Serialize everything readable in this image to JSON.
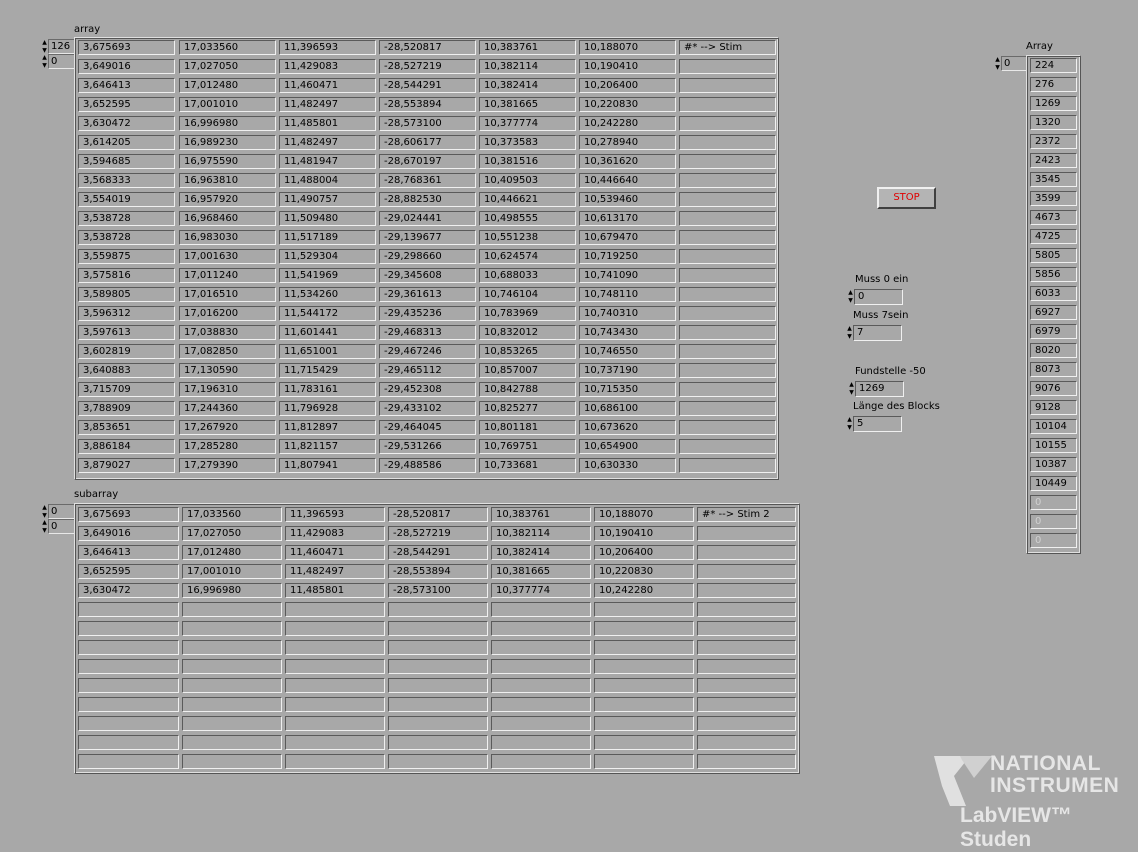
{
  "array": {
    "label": "array",
    "index_row": "126",
    "index_col": "0",
    "rows": [
      [
        "3,675693",
        "17,033560",
        "11,396593",
        "-28,520817",
        "10,383761",
        "10,188070",
        "#*    -->    Stim"
      ],
      [
        "3,649016",
        "17,027050",
        "11,429083",
        "-28,527219",
        "10,382114",
        "10,190410",
        ""
      ],
      [
        "3,646413",
        "17,012480",
        "11,460471",
        "-28,544291",
        "10,382414",
        "10,206400",
        ""
      ],
      [
        "3,652595",
        "17,001010",
        "11,482497",
        "-28,553894",
        "10,381665",
        "10,220830",
        ""
      ],
      [
        "3,630472",
        "16,996980",
        "11,485801",
        "-28,573100",
        "10,377774",
        "10,242280",
        ""
      ],
      [
        "3,614205",
        "16,989230",
        "11,482497",
        "-28,606177",
        "10,373583",
        "10,278940",
        ""
      ],
      [
        "3,594685",
        "16,975590",
        "11,481947",
        "-28,670197",
        "10,381516",
        "10,361620",
        ""
      ],
      [
        "3,568333",
        "16,963810",
        "11,488004",
        "-28,768361",
        "10,409503",
        "10,446640",
        ""
      ],
      [
        "3,554019",
        "16,957920",
        "11,490757",
        "-28,882530",
        "10,446621",
        "10,539460",
        ""
      ],
      [
        "3,538728",
        "16,968460",
        "11,509480",
        "-29,024441",
        "10,498555",
        "10,613170",
        ""
      ],
      [
        "3,538728",
        "16,983030",
        "11,517189",
        "-29,139677",
        "10,551238",
        "10,679470",
        ""
      ],
      [
        "3,559875",
        "17,001630",
        "11,529304",
        "-29,298660",
        "10,624574",
        "10,719250",
        ""
      ],
      [
        "3,575816",
        "17,011240",
        "11,541969",
        "-29,345608",
        "10,688033",
        "10,741090",
        ""
      ],
      [
        "3,589805",
        "17,016510",
        "11,534260",
        "-29,361613",
        "10,746104",
        "10,748110",
        ""
      ],
      [
        "3,596312",
        "17,016200",
        "11,544172",
        "-29,435236",
        "10,783969",
        "10,740310",
        ""
      ],
      [
        "3,597613",
        "17,038830",
        "11,601441",
        "-29,468313",
        "10,832012",
        "10,743430",
        ""
      ],
      [
        "3,602819",
        "17,082850",
        "11,651001",
        "-29,467246",
        "10,853265",
        "10,746550",
        ""
      ],
      [
        "3,640883",
        "17,130590",
        "11,715429",
        "-29,465112",
        "10,857007",
        "10,737190",
        ""
      ],
      [
        "3,715709",
        "17,196310",
        "11,783161",
        "-29,452308",
        "10,842788",
        "10,715350",
        ""
      ],
      [
        "3,788909",
        "17,244360",
        "11,796928",
        "-29,433102",
        "10,825277",
        "10,686100",
        ""
      ],
      [
        "3,853651",
        "17,267920",
        "11,812897",
        "-29,464045",
        "10,801181",
        "10,673620",
        ""
      ],
      [
        "3,886184",
        "17,285280",
        "11,821157",
        "-29,531266",
        "10,769751",
        "10,654900",
        ""
      ],
      [
        "3,879027",
        "17,279390",
        "11,807941",
        "-29,488586",
        "10,733681",
        "10,630330",
        ""
      ]
    ]
  },
  "subarray": {
    "label": "subarray",
    "index_row": "0",
    "index_col": "0",
    "rows": [
      [
        "3,675693",
        "17,033560",
        "11,396593",
        "-28,520817",
        "10,383761",
        "10,188070",
        "#*    -->     Stim 2"
      ],
      [
        "3,649016",
        "17,027050",
        "11,429083",
        "-28,527219",
        "10,382114",
        "10,190410",
        ""
      ],
      [
        "3,646413",
        "17,012480",
        "11,460471",
        "-28,544291",
        "10,382414",
        "10,206400",
        ""
      ],
      [
        "3,652595",
        "17,001010",
        "11,482497",
        "-28,553894",
        "10,381665",
        "10,220830",
        ""
      ],
      [
        "3,630472",
        "16,996980",
        "11,485801",
        "-28,573100",
        "10,377774",
        "10,242280",
        ""
      ],
      [
        "",
        "",
        "",
        "",
        "",
        "",
        ""
      ],
      [
        "",
        "",
        "",
        "",
        "",
        "",
        ""
      ],
      [
        "",
        "",
        "",
        "",
        "",
        "",
        ""
      ],
      [
        "",
        "",
        "",
        "",
        "",
        "",
        ""
      ],
      [
        "",
        "",
        "",
        "",
        "",
        "",
        ""
      ],
      [
        "",
        "",
        "",
        "",
        "",
        "",
        ""
      ],
      [
        "",
        "",
        "",
        "",
        "",
        "",
        ""
      ],
      [
        "",
        "",
        "",
        "",
        "",
        "",
        ""
      ],
      [
        "",
        "",
        "",
        "",
        "",
        "",
        ""
      ]
    ]
  },
  "stop_button": {
    "label": "STOP",
    "color": "#e00000"
  },
  "controls": {
    "muss0": {
      "label": "Muss 0 ein",
      "value": "0"
    },
    "muss7": {
      "label": "Muss 7sein",
      "value": "7"
    },
    "fundstelle": {
      "label": "Fundstelle -50",
      "value": "1269"
    },
    "laenge": {
      "label": "Länge des Blocks",
      "value": "5"
    }
  },
  "found_array": {
    "label": "Array",
    "index": "0",
    "values": [
      "224",
      "276",
      "1269",
      "1320",
      "2372",
      "2423",
      "3545",
      "3599",
      "4673",
      "4725",
      "5805",
      "5856",
      "6033",
      "6927",
      "6979",
      "8020",
      "8073",
      "9076",
      "9128",
      "10104",
      "10155",
      "10387",
      "10449",
      "0",
      "0",
      "0"
    ],
    "active_count": 23
  },
  "logo": {
    "line1": "NATIONAL",
    "line2": "INSTRUMEN",
    "line3": "LabVIEW™ Studen"
  }
}
